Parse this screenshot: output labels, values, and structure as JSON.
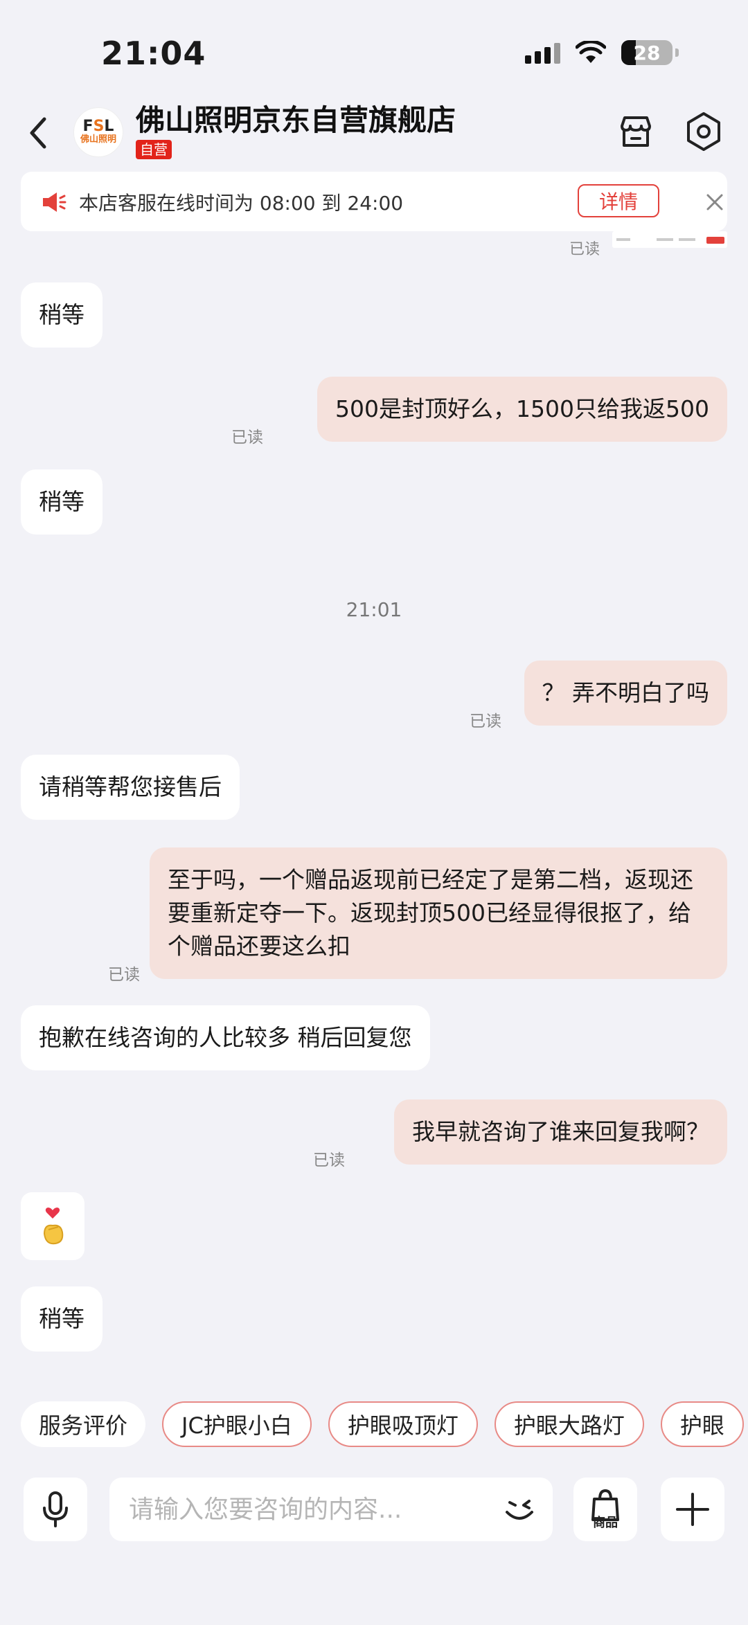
{
  "status_bar": {
    "time": "21:04",
    "battery": "28"
  },
  "header": {
    "shop_name": "佛山照明京东自营旗舰店",
    "self_operated_badge": "自营",
    "logo_top_left": "F",
    "logo_top_mid": "S",
    "logo_top_right": "L",
    "logo_bottom": "佛山照明"
  },
  "notice": {
    "text": "本店客服在线时间为 08:00 到 24:00",
    "detail_label": "详情"
  },
  "chat": {
    "top_read_label": "已读",
    "messages": [
      {
        "direction": "in",
        "text": "稍等"
      },
      {
        "direction": "out",
        "text": "500是封顶好么，1500只给我返500",
        "read": "已读"
      },
      {
        "direction": "in",
        "text": "稍等"
      },
      {
        "direction": "out",
        "text": "？ 弄不明白了吗",
        "read": "已读"
      },
      {
        "direction": "in",
        "text": "请稍等帮您接售后"
      },
      {
        "direction": "out",
        "text": "至于吗，一个赠品返现前已经定了是第二档，返现还要重新定夺一下。返现封顶500已经显得很抠了，给个赠品还要这么扣",
        "read": "已读"
      },
      {
        "direction": "in",
        "text": "抱歉在线咨询的人比较多 稍后回复您"
      },
      {
        "direction": "out",
        "text": "我早就咨询了谁来回复我啊？",
        "read": "已读"
      },
      {
        "direction": "in",
        "text": "稍等"
      }
    ],
    "time_separator": "21:01",
    "sticker_icon": "finger-heart-emoji"
  },
  "quick_replies": [
    "服务评价",
    "JC护眼小白",
    "护眼吸顶灯",
    "护眼大路灯",
    "护眼"
  ],
  "input_bar": {
    "placeholder": "请输入您要咨询的内容...",
    "product_label": "商品"
  },
  "colors": {
    "background": "#f2f2f7",
    "outgoing_bubble": "#f5e1dc",
    "accent_red": "#e3413b",
    "badge_red": "#e2231a"
  }
}
